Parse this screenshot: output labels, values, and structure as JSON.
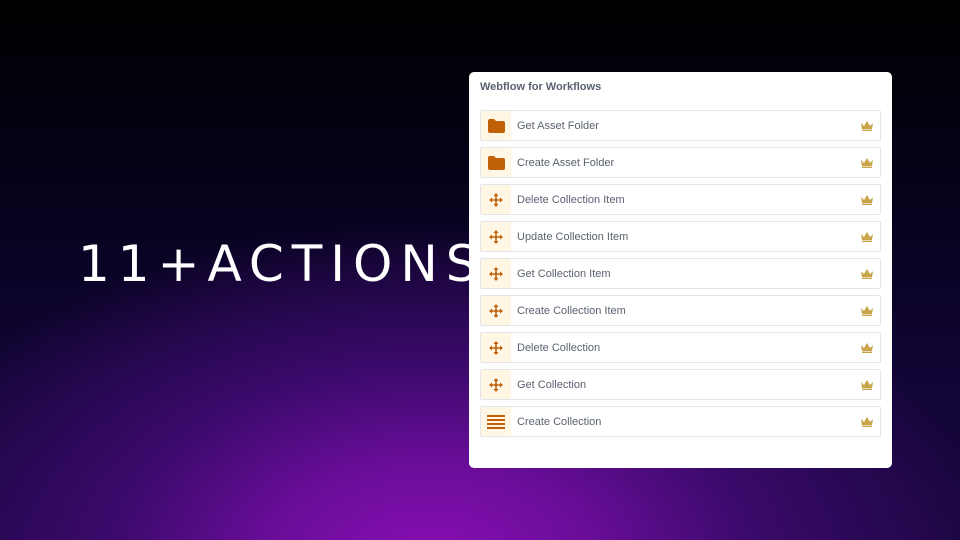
{
  "headline": "11+ACTIONS",
  "panel": {
    "title": "Webflow for Workflows",
    "items": [
      {
        "label": "Get Asset Folder",
        "icon": "folder-icon"
      },
      {
        "label": "Create Asset Folder",
        "icon": "folder-icon"
      },
      {
        "label": "Delete Collection Item",
        "icon": "move-arrows-icon"
      },
      {
        "label": "Update Collection Item",
        "icon": "move-arrows-icon"
      },
      {
        "label": "Get Collection Item",
        "icon": "move-arrows-icon"
      },
      {
        "label": "Create Collection Item",
        "icon": "move-arrows-icon"
      },
      {
        "label": "Delete Collection",
        "icon": "move-arrows-icon"
      },
      {
        "label": "Get Collection",
        "icon": "move-arrows-icon"
      },
      {
        "label": "Create Collection",
        "icon": "list-lines-icon"
      }
    ],
    "badge_icon": "crown-icon"
  },
  "colors": {
    "icon_accent": "#c0610a",
    "crown": "#c8a44a",
    "icon_bg": "#fff6e4",
    "label_text": "#5a6270"
  }
}
